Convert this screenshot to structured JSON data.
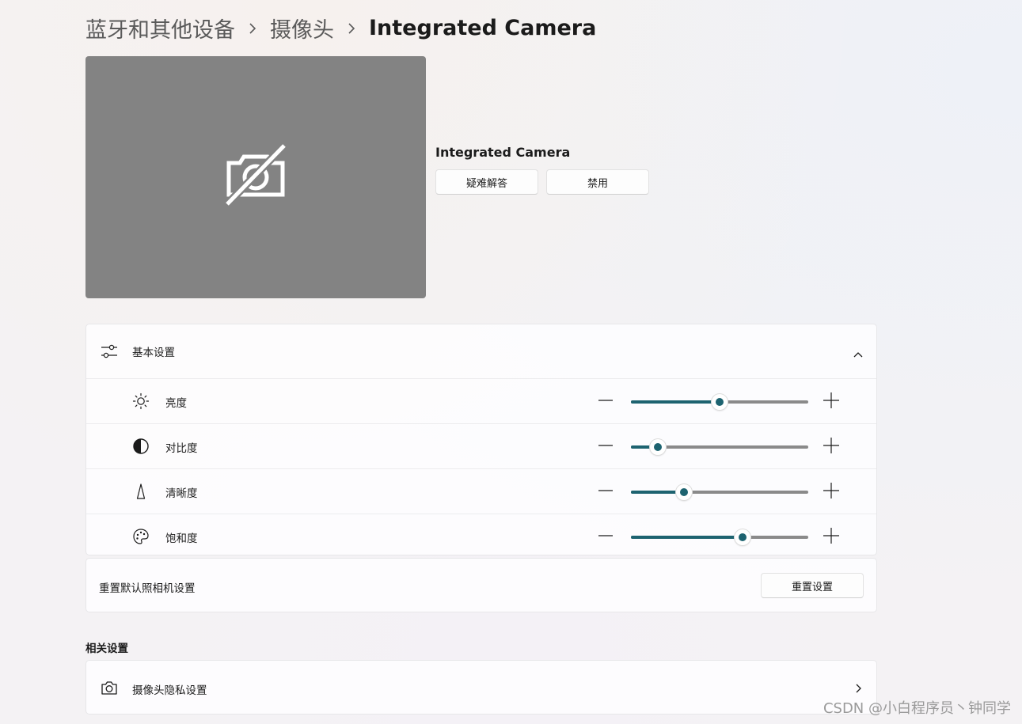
{
  "breadcrumb": {
    "items": [
      "蓝牙和其他设备",
      "摄像头",
      "Integrated Camera"
    ]
  },
  "camera": {
    "name": "Integrated Camera",
    "preview_icon": "camera-off-icon",
    "troubleshoot_label": "疑难解答",
    "disable_label": "禁用"
  },
  "basic_settings": {
    "title": "基本设置",
    "icon": "sliders-icon",
    "expanded": true,
    "sliders": [
      {
        "label": "亮度",
        "icon": "brightness-icon",
        "value": 0.5
      },
      {
        "label": "对比度",
        "icon": "contrast-icon",
        "value": 0.15
      },
      {
        "label": "清晰度",
        "icon": "sharpness-icon",
        "value": 0.3
      },
      {
        "label": "饱和度",
        "icon": "saturation-icon",
        "value": 0.63
      }
    ]
  },
  "reset": {
    "label": "重置默认照相机设置",
    "button_label": "重置设置"
  },
  "related": {
    "title": "相关设置",
    "items": [
      {
        "label": "摄像头隐私设置",
        "icon": "camera-icon"
      }
    ]
  },
  "watermark": "CSDN @小白程序员丶钟同学",
  "colors": {
    "accent": "#1d6370",
    "preview_bg": "#838383",
    "track": "#8a8a8a"
  }
}
